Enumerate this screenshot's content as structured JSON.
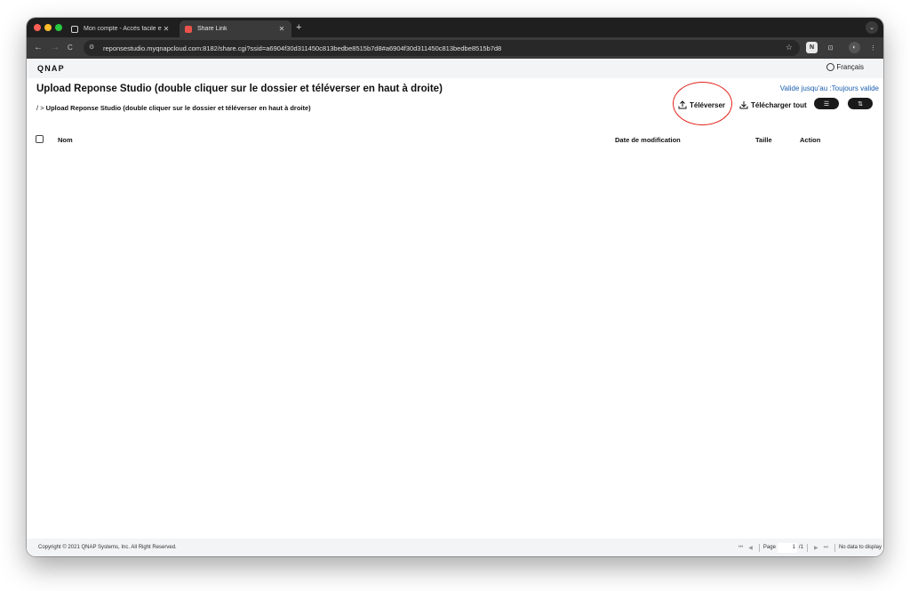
{
  "browser": {
    "tabs": [
      {
        "title": "Mon compte - Accès facile et",
        "close": "✕"
      },
      {
        "title": "Share Link",
        "close": "✕"
      }
    ],
    "new_tab": "+",
    "menu": "⌄",
    "nav": {
      "back": "←",
      "forward": "→",
      "reload": "C"
    },
    "url": "reponsestudio.myqnapcloud.com:8182/share.cgi?ssid=a6904f30d311450c813bedbe8515b7d8#a6904f30d311450c813bedbe8515b7d8",
    "star": "☆",
    "extensions": [
      "N",
      "⊡",
      "◐",
      "⋮"
    ]
  },
  "header": {
    "logo": "QNAP",
    "language": "Français"
  },
  "main": {
    "title": "Upload Reponse Studio (double cliquer sur le dossier et téléverser en haut à droite)",
    "valid_until": "Valide jusqu'au :Toujours valide",
    "breadcrumb_root": "/",
    "breadcrumb_sep": ">",
    "breadcrumb_current": "Upload Reponse Studio (double cliquer sur le dossier et téléverser en haut à droite)",
    "upload_label": "Téléverser",
    "download_all_label": "Télécharger tout",
    "list_view_icon": "☰",
    "sort_icon": "⇅"
  },
  "table": {
    "columns": [
      "Nom",
      "Date de modification",
      "Taille",
      "Action"
    ]
  },
  "footer": {
    "copyright": "Copyright © 2021 QNAP Systems, Inc. All Right Reserved.",
    "page_label": "Page",
    "page_current": "1",
    "page_total": "/1",
    "no_data": "No data to display"
  }
}
